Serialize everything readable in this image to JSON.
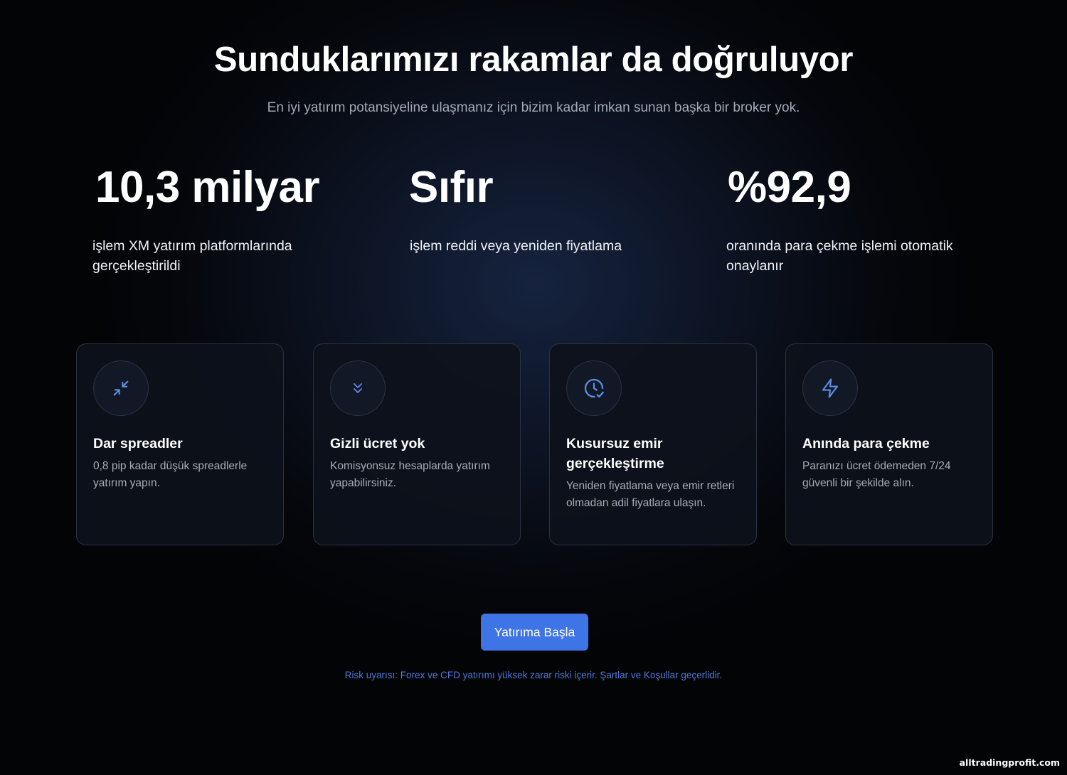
{
  "header": {
    "title": "Sunduklarımızı rakamlar da doğruluyor",
    "subtitle": "En iyi yatırım potansiyeline ulaşmanız için bizim kadar imkan sunan başka bir broker yok."
  },
  "stats": [
    {
      "value": "10,3 milyar",
      "description": "işlem XM yatırım platformlarında gerçekleştirildi"
    },
    {
      "value": "Sıfır",
      "description": "işlem reddi veya yeniden fiyatlama"
    },
    {
      "value": "%92,9",
      "description": "oranında para çekme işlemi otomatik onaylanır"
    }
  ],
  "features": [
    {
      "icon": "compress-arrows-icon",
      "title": "Dar spreadler",
      "text": "0,8 pip kadar düşük spreadlerle yatırım yapın."
    },
    {
      "icon": "double-chevron-down-icon",
      "title": "Gizli ücret yok",
      "text": "Komisyonsuz hesaplarda yatırım yapabilirsiniz."
    },
    {
      "icon": "clock-check-icon",
      "title": "Kusursuz emir gerçekleştirme",
      "text": "Yeniden fiyatlama veya emir retleri olmadan adil fiyatlara ulaşın."
    },
    {
      "icon": "lightning-bolt-icon",
      "title": "Anında para çekme",
      "text": "Paranızı ücret ödemeden 7/24 güvenli bir şekilde alın."
    }
  ],
  "cta": {
    "label": "Yatırıma Başla"
  },
  "risk_warning": "Risk uyarısı: Forex ve CFD yatırımı yüksek zarar riski içerir. Şartlar ve Koşullar geçerlidir.",
  "watermark": "alltradingprofit.com",
  "colors": {
    "accent": "#3f74e6",
    "icon_stroke": "#5b8fe6",
    "risk_text": "#4f79d8"
  }
}
